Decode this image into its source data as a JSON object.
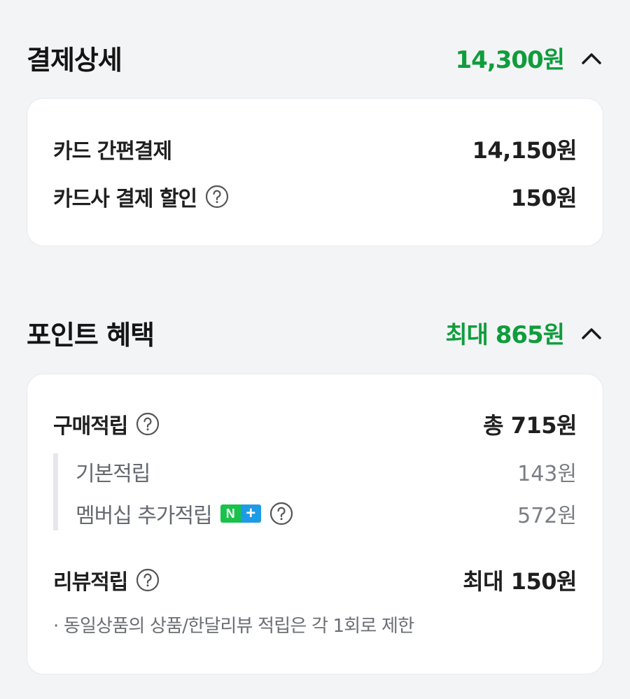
{
  "payment": {
    "title": "결제상세",
    "total": "14,300원",
    "items": [
      {
        "label": "카드 간편결제",
        "value": "14,150원"
      },
      {
        "label": "카드사 결제 할인",
        "value": "150원"
      }
    ]
  },
  "points": {
    "title": "포인트 혜택",
    "total": "최대 865원",
    "purchase": {
      "label": "구매적립",
      "value": "총 715원",
      "basic_label": "기본적립",
      "basic_value": "143원",
      "membership_label": "멤버십 추가적립",
      "membership_value": "572원",
      "badge_n": "N",
      "badge_plus": "+"
    },
    "review": {
      "label": "리뷰적립",
      "value": "최대 150원",
      "note": "· 동일상품의 상품/한달리뷰 적립은 각 1회로 제한"
    }
  },
  "colors": {
    "accent_green": "#0f9d3c",
    "background": "#f3f4f6",
    "card": "#ffffff",
    "badge_green": "#19c24a",
    "badge_blue": "#1e9be6"
  },
  "icons": [
    "chevron-up-icon",
    "help-circle-icon"
  ]
}
